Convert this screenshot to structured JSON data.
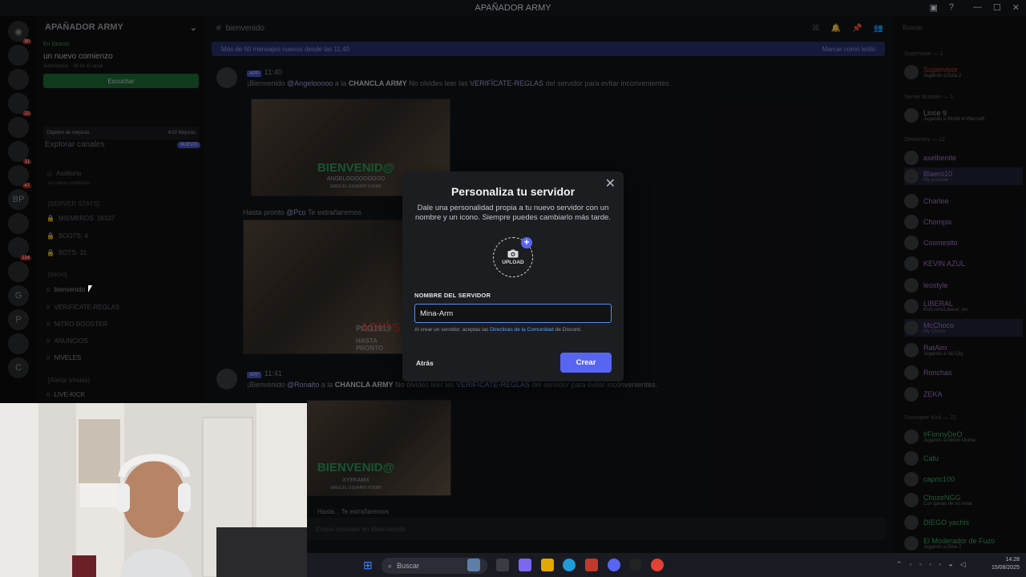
{
  "window": {
    "title": "APAÑADOR ARMY"
  },
  "server": {
    "name": "APAÑADOR ARMY",
    "live": {
      "label": "En Directo",
      "title": "un nuevo comienzo",
      "sub": "Autorizados · 28 en el canal",
      "button": "Escuchar"
    },
    "goal": {
      "label": "Objetivo de mejoras",
      "value": "4/30 Mejoras"
    },
    "explore": {
      "label": "Explorar canales",
      "badge": "NUEVO"
    },
    "channels": [
      {
        "name": "Auditorio",
        "sub": "un nuevo comienzo"
      },
      {
        "name": "[SERVER STATS]"
      },
      {
        "name": "MIEMBROS: 16107"
      },
      {
        "name": "BOOTS: 4"
      },
      {
        "name": "BOTS: 31"
      },
      {
        "name": "[Inicio]"
      },
      {
        "name": "bienvenido"
      },
      {
        "name": "VERIFÍCATE-REGLAS"
      },
      {
        "name": "NITRO-BOOSTER"
      },
      {
        "name": "ANUNCIOS"
      },
      {
        "name": "NIVELES"
      },
      {
        "name": "[Alerta Vindas]"
      },
      {
        "name": "LIVE-KICK"
      }
    ]
  },
  "rail": {
    "letters": [
      "BP",
      "G",
      "P",
      "C"
    ],
    "badges": [
      "90",
      "22",
      "11",
      "47",
      "114"
    ]
  },
  "chat": {
    "channel": "bienvenido",
    "newmsg": {
      "text": "Más de 50 mensajes nuevos desde las 11:40",
      "action": "Marcar como leído"
    },
    "msg1": {
      "tag": "APP",
      "time": "11:40",
      "pre": "¡Bienvenido ",
      "user": "@Angelooooo",
      "mid": " a la ",
      "server": "CHANCLA ARMY",
      "tail": " No olvides leer las ",
      "channel": "VERIFÍCATE-REGLAS",
      "end": " del servidor para evitar inconvenientes."
    },
    "img1": {
      "title": "BIENVENID@",
      "user": "ANGELOOOOOOOOO",
      "count": "ERES EL USUARIO #16080"
    },
    "bye1": {
      "pre": "Hasta pronto ",
      "user": "@Pco",
      "end": " Te extrañaremos"
    },
    "img2": {
      "tag": "ADIÓS",
      "user": "PCO1919",
      "sub": "HASTA PRONTO"
    },
    "msg2": {
      "tag": "APP",
      "time": "11:41",
      "pre": "¡Bienvenido ",
      "user": "@Ronalto",
      "mid": " a la ",
      "server": "CHANCLA ARMY",
      "tail": " No olvides leer las ",
      "channel": "VERIFÍCATE-REGLAS",
      "end": " del servidor para evitar inconvenientes."
    },
    "img3": {
      "title": "BIENVENID@",
      "user": "XYEKAMX",
      "count": "ERES EL USUARIO #16080"
    },
    "bye2": {
      "text": "Hasta... Te extrañaremos"
    },
    "input_placeholder": "Enviar mensaje en #bienvenido"
  },
  "members": {
    "search": "Buscar",
    "groups": [
      {
        "label": "Supervisor — 1"
      },
      {
        "label": "Server Booster — 1"
      },
      {
        "label": "Streamers — 12"
      },
      {
        "label": "Suscriptor Kick — 21"
      }
    ],
    "list": [
      {
        "name": "Supervisor",
        "sub": "Jugando a Dota 2",
        "color": "#c0392b"
      },
      {
        "name": "Lince 9",
        "sub": "Jugando a World of Warcraft",
        "color": "#8a8e94"
      },
      {
        "name": "axelbenite",
        "sub": "",
        "color": "#a872c9"
      },
      {
        "name": "Blaero10",
        "sub": "My youtube",
        "color": "#a872c9"
      },
      {
        "name": "Charlee",
        "sub": "",
        "color": "#a872c9"
      },
      {
        "name": "Chompix",
        "sub": "",
        "color": "#a872c9"
      },
      {
        "name": "Cosmesito",
        "sub": "",
        "color": "#a872c9"
      },
      {
        "name": "KEVIN AZUL",
        "sub": "",
        "color": "#a872c9"
      },
      {
        "name": "leostyle",
        "sub": "",
        "color": "#a872c9"
      },
      {
        "name": "LIBERAL",
        "sub": "Kick.com/Liberal_mx",
        "color": "#a872c9"
      },
      {
        "name": "McChoco",
        "sub": "My Choco",
        "color": "#a872c9"
      },
      {
        "name": "RatAim",
        "sub": "Jugando a Val City",
        "color": "#a872c9"
      },
      {
        "name": "Ronchas",
        "sub": "",
        "color": "#a872c9"
      },
      {
        "name": "ZEKA",
        "sub": "",
        "color": "#a872c9"
      },
      {
        "name": "#FonnyDeO",
        "sub": "Jugando a Albion Online",
        "color": "#3ba55d"
      },
      {
        "name": "Cafu",
        "sub": "",
        "color": "#3ba55d"
      },
      {
        "name": "capric100",
        "sub": "",
        "color": "#3ba55d"
      },
      {
        "name": "ChozeNGG",
        "sub": "Con ganas de no mirar",
        "color": "#3ba55d"
      },
      {
        "name": "DIEGO yachis",
        "sub": "",
        "color": "#3ba55d"
      },
      {
        "name": "El Moderador de Fuzo",
        "sub": "Jugando a Dota 2",
        "color": "#3ba55d"
      }
    ]
  },
  "modal": {
    "title": "Personaliza tu servidor",
    "description": "Dale una personalidad propia a tu nuevo servidor con un nombre y un icono. Siempre puedes cambiarlo más tarde.",
    "upload_label": "UPLOAD",
    "field_label": "NOMBRE DEL SERVIDOR",
    "field_value": "Mina-Arm",
    "terms_pre": "Al crear un servidor, aceptas las ",
    "terms_link": "Directivas de la Comunidad",
    "terms_post": " de Discord.",
    "back": "Atrás",
    "create": "Crear"
  },
  "taskbar": {
    "search": "Buscar",
    "time": "14:28",
    "date": "15/08/2025"
  },
  "colors": {
    "accent": "#5865f2",
    "link": "#5aa1ff",
    "live": "#1e6b34"
  }
}
